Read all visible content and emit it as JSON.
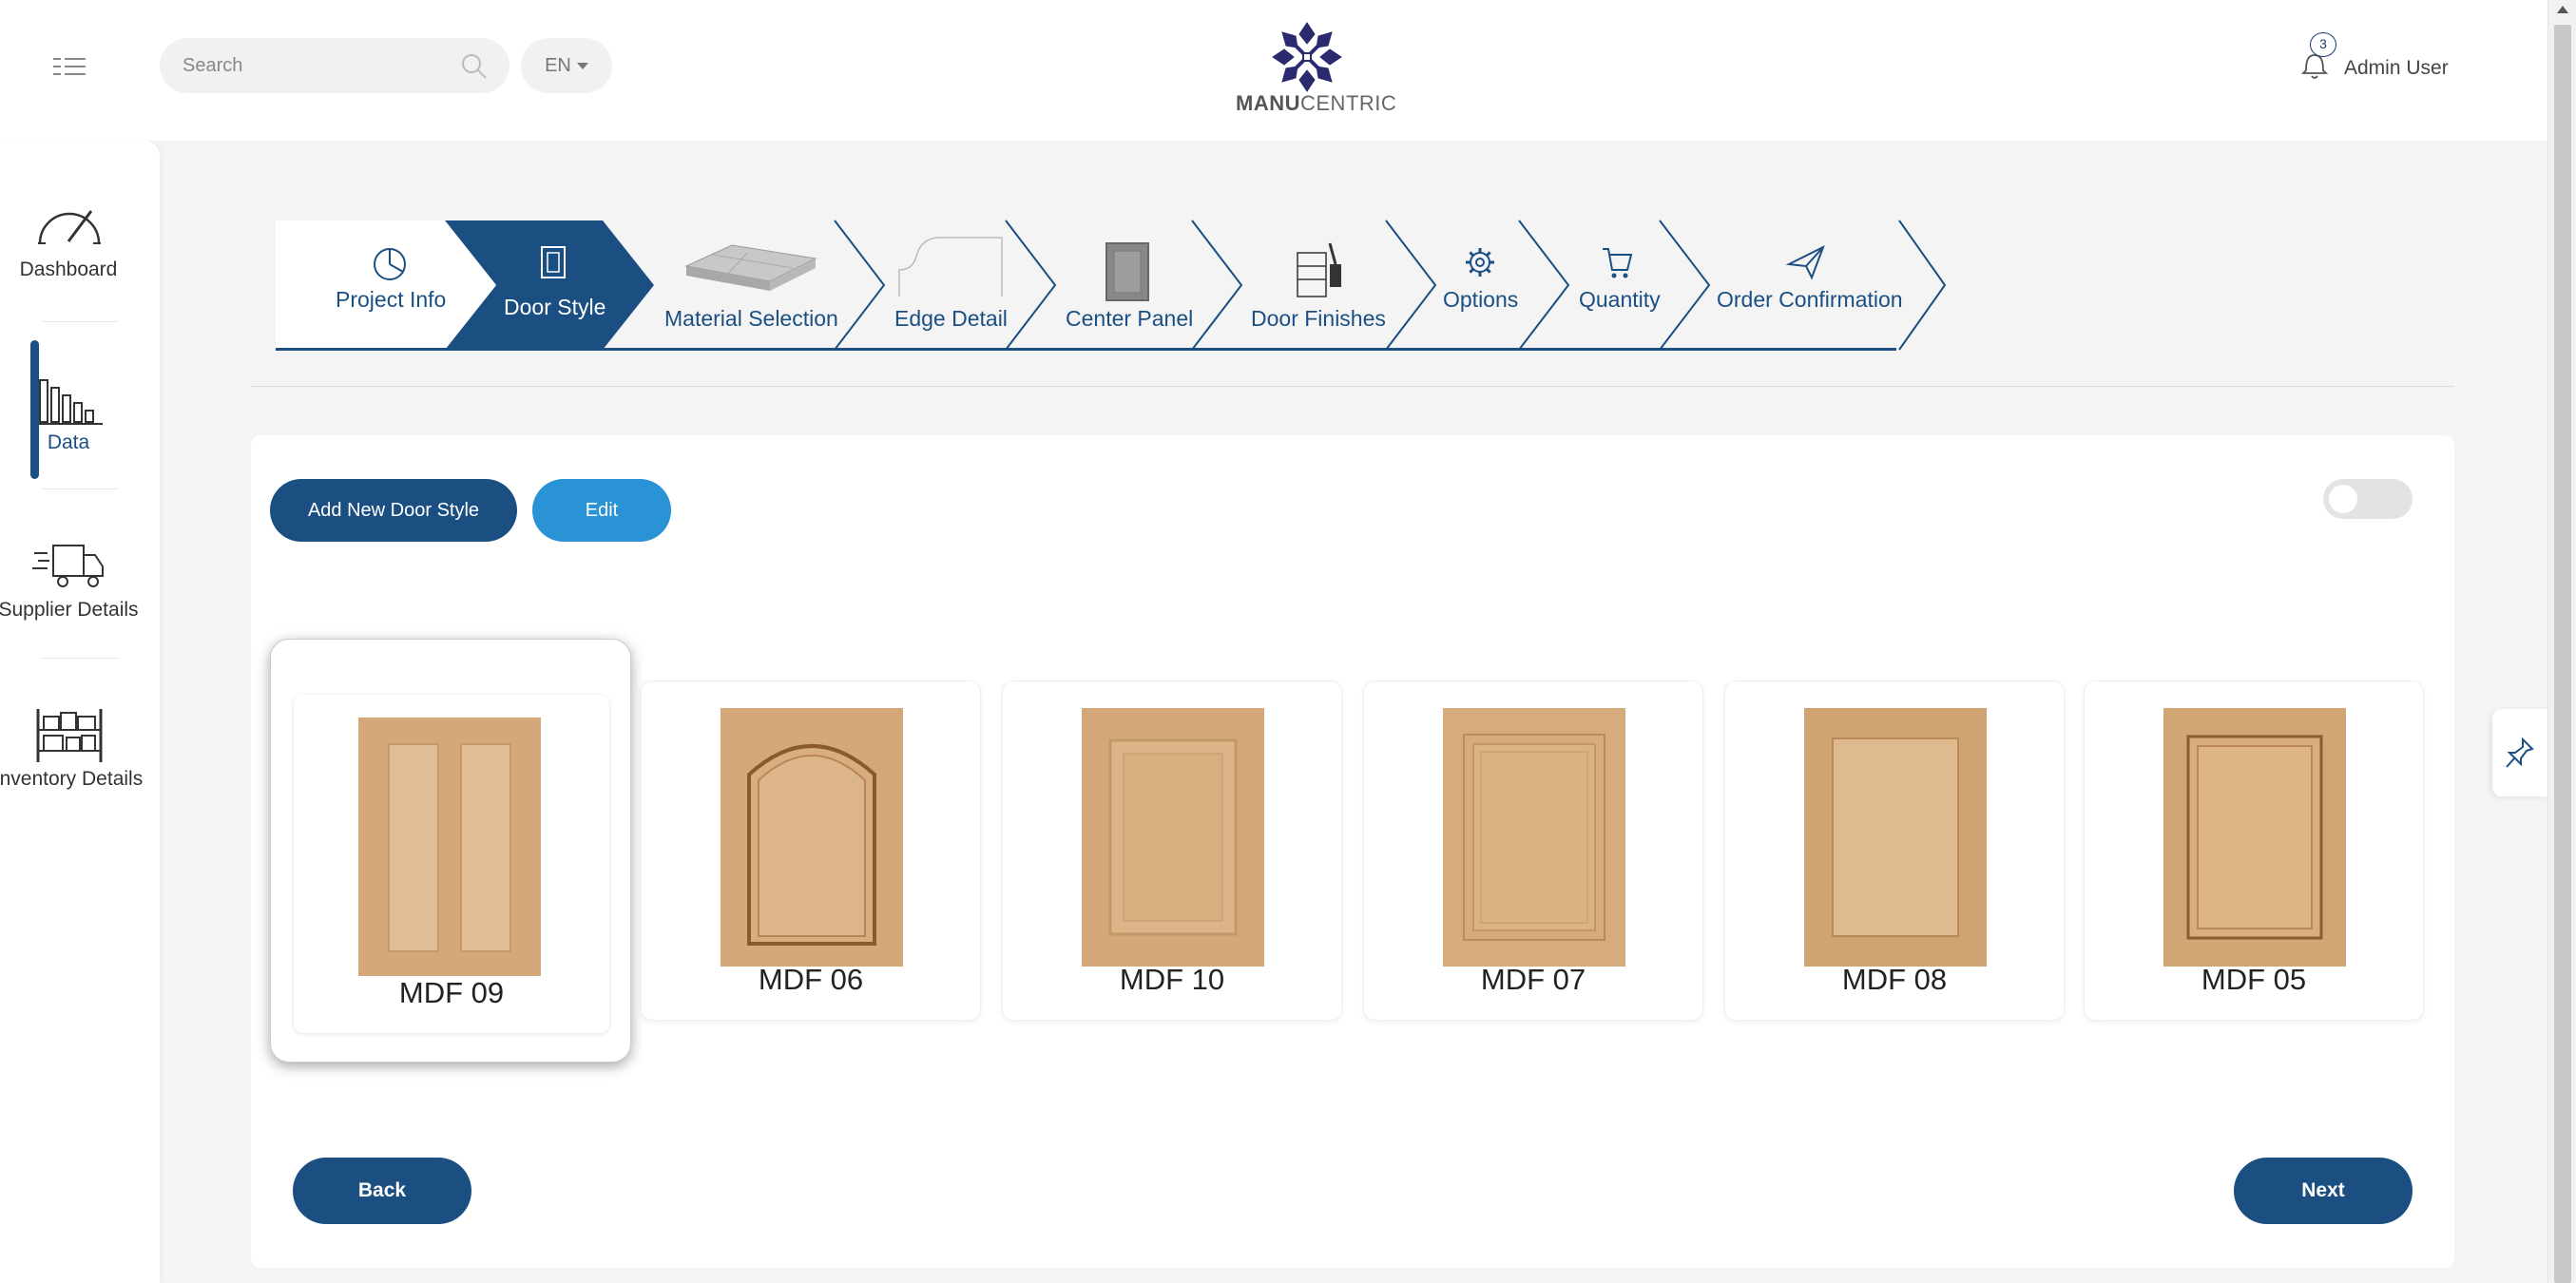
{
  "header": {
    "search_placeholder": "Search",
    "language": "EN",
    "logo_main": "MANU",
    "logo_accent": "CENTRIC",
    "notification_count": "3",
    "user_name": "Admin User"
  },
  "sidebar": {
    "items": [
      {
        "label": "Dashboard",
        "icon": "gauge-icon"
      },
      {
        "label": "Data",
        "icon": "bar-chart-icon",
        "active": true
      },
      {
        "label": "Supplier Details",
        "icon": "delivery-truck-icon"
      },
      {
        "label": "Inventory Details",
        "icon": "shelving-icon"
      }
    ]
  },
  "wizard": {
    "steps": [
      {
        "label": "Project Info",
        "icon": "pie-chart-icon"
      },
      {
        "label": "Door Style",
        "icon": "door-icon",
        "active": true
      },
      {
        "label": "Material Selection",
        "icon": "material-slab-icon"
      },
      {
        "label": "Edge Detail",
        "icon": "edge-profile-icon"
      },
      {
        "label": "Center Panel",
        "icon": "center-panel-icon"
      },
      {
        "label": "Door Finishes",
        "icon": "finish-brush-icon"
      },
      {
        "label": "Options",
        "icon": "gear-icon"
      },
      {
        "label": "Quantity",
        "icon": "cart-icon"
      },
      {
        "label": "Order Confirmation",
        "icon": "paper-plane-icon"
      }
    ]
  },
  "toolbar": {
    "add_label": "Add New Door Style",
    "edit_label": "Edit"
  },
  "door_styles": [
    {
      "label": "MDF 09",
      "selected": true,
      "style": "two-panel"
    },
    {
      "label": "MDF 06",
      "style": "arched"
    },
    {
      "label": "MDF 10",
      "style": "raised"
    },
    {
      "label": "MDF 07",
      "style": "beaded"
    },
    {
      "label": "MDF 08",
      "style": "recessed"
    },
    {
      "label": "MDF 05",
      "style": "shaker"
    }
  ],
  "navigation": {
    "back_label": "Back",
    "next_label": "Next"
  },
  "colors": {
    "primary": "#1b4f82",
    "edit_blue": "#2a93d5",
    "door_wood": "#d4a878"
  }
}
